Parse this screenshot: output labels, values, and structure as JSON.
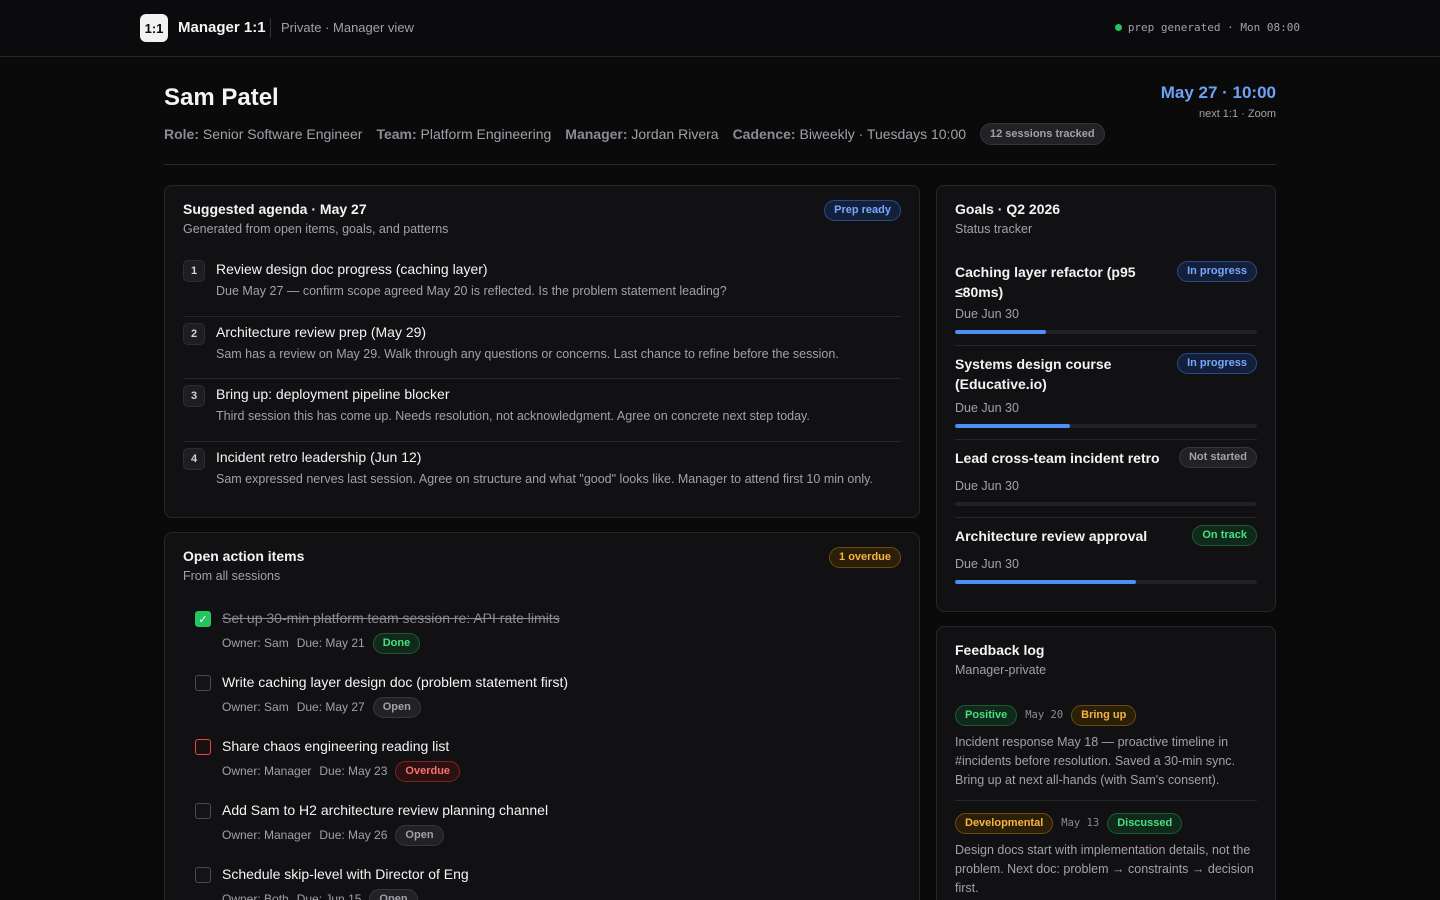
{
  "topbar": {
    "logo": "1:1",
    "app_title": "Manager 1:1",
    "subtitle": "Private · Manager view",
    "status": "prep generated · Mon 08:00",
    "status_color": "#22c55e"
  },
  "person": {
    "name": "Sam Patel",
    "role_label": "Role:",
    "role": "Senior Software Engineer",
    "team_label": "Team:",
    "team": "Platform Engineering",
    "manager_label": "Manager:",
    "manager": "Jordan Rivera",
    "cadence_label": "Cadence:",
    "cadence": "Biweekly · Tuesdays 10:00",
    "sessions": "12 sessions tracked"
  },
  "next_session": {
    "datetime": "May 27 · 10:00",
    "detail": "next 1:1 · Zoom"
  },
  "agenda": {
    "title": "Suggested agenda · May 27",
    "subtitle": "Generated from open items, goals, and patterns",
    "badge": "Prep ready",
    "items": [
      {
        "num": "1",
        "title": "Review design doc progress (caching layer)",
        "desc": "Due May 27 — confirm scope agreed May 20 is reflected. Is the problem statement leading?"
      },
      {
        "num": "2",
        "title": "Architecture review prep (May 29)",
        "desc": "Sam has a review on May 29. Walk through any questions or concerns. Last chance to refine before the session."
      },
      {
        "num": "3",
        "title": "Bring up: deployment pipeline blocker",
        "desc": "Third session this has come up. Needs resolution, not acknowledgment. Agree on concrete next step today."
      },
      {
        "num": "4",
        "title": "Incident retro leadership (Jun 12)",
        "desc": "Sam expressed nerves last session. Agree on structure and what \"good\" looks like. Manager to attend first 10 min only."
      }
    ]
  },
  "actions": {
    "title": "Open action items",
    "subtitle": "From all sessions",
    "badge": "1 overdue",
    "items": [
      {
        "title": "Set up 30-min platform team session re: API rate limits",
        "owner": "Owner: Sam",
        "due": "Due: May 21",
        "status": "Done"
      },
      {
        "title": "Write caching layer design doc (problem statement first)",
        "owner": "Owner: Sam",
        "due": "Due: May 27",
        "status": "Open"
      },
      {
        "title": "Share chaos engineering reading list",
        "owner": "Owner: Manager",
        "due": "Due: May 23",
        "status": "Overdue"
      },
      {
        "title": "Add Sam to H2 architecture review planning channel",
        "owner": "Owner: Manager",
        "due": "Due: May 26",
        "status": "Open"
      },
      {
        "title": "Schedule skip-level with Director of Eng",
        "owner": "Owner: Both",
        "due": "Due: Jun 15",
        "status": "Open"
      }
    ]
  },
  "goals": {
    "title": "Goals · Q2 2026",
    "subtitle": "Status tracker",
    "items": [
      {
        "title": "Caching layer refactor (p95 ≤80ms)",
        "status": "In progress",
        "due": "Due Jun 30",
        "progress": 0.3
      },
      {
        "title": "Systems design course (Educative.io)",
        "status": "In progress",
        "due": "Due Jun 30",
        "progress": 0.38
      },
      {
        "title": "Lead cross-team incident retro",
        "status": "Not started",
        "due": "Due Jun 30",
        "progress": 0
      },
      {
        "title": "Architecture review approval",
        "status": "On track",
        "due": "Due Jun 30",
        "progress": 0.6
      }
    ]
  },
  "feedback": {
    "title": "Feedback log",
    "subtitle": "Manager-private",
    "items": [
      {
        "type": "Positive",
        "date": "May 20",
        "tag": "Bring up",
        "text": "Incident response May 18 — proactive timeline in #incidents before resolution. Saved a 30-min sync. Bring up at next all-hands (with Sam's consent)."
      },
      {
        "type": "Developmental",
        "date": "May 13",
        "tag": "Discussed",
        "text": "Design docs start with implementation details, not the problem. Next doc: problem → constraints → decision first."
      }
    ]
  }
}
